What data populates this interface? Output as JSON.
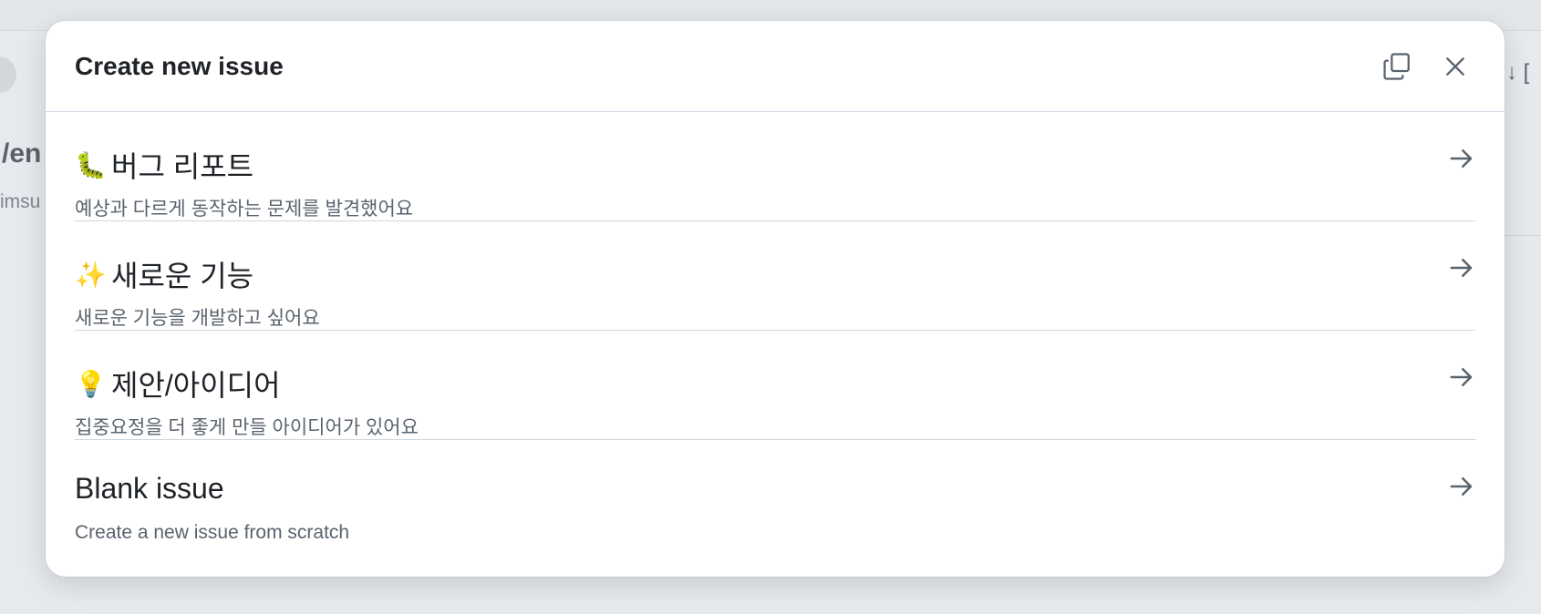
{
  "background": {
    "title_fragment": "/en",
    "subtitle_fragment": "imsu",
    "sort_glyph": "↑↓ ["
  },
  "modal": {
    "title": "Create new issue",
    "copy_icon": "copy-icon",
    "close_icon": "close-icon"
  },
  "options": [
    {
      "emoji": "🐛",
      "title": "버그 리포트",
      "description": "예상과 다르게 동작하는 문제를 발견했어요",
      "icon": "arrow-right-icon"
    },
    {
      "emoji": "✨",
      "title": "새로운 기능",
      "description": "새로운 기능을 개발하고 싶어요",
      "icon": "arrow-right-icon"
    },
    {
      "emoji": "💡",
      "title": "제안/아이디어",
      "description": "집중요정을 더 좋게 만들 아이디어가 있어요",
      "icon": "arrow-right-icon"
    },
    {
      "emoji": "",
      "title": "Blank issue",
      "description": "Create a new issue from scratch",
      "icon": "arrow-right-icon"
    }
  ],
  "colors": {
    "text_primary": "#1f2328",
    "text_secondary": "#59636e",
    "divider": "#d0d7de"
  }
}
